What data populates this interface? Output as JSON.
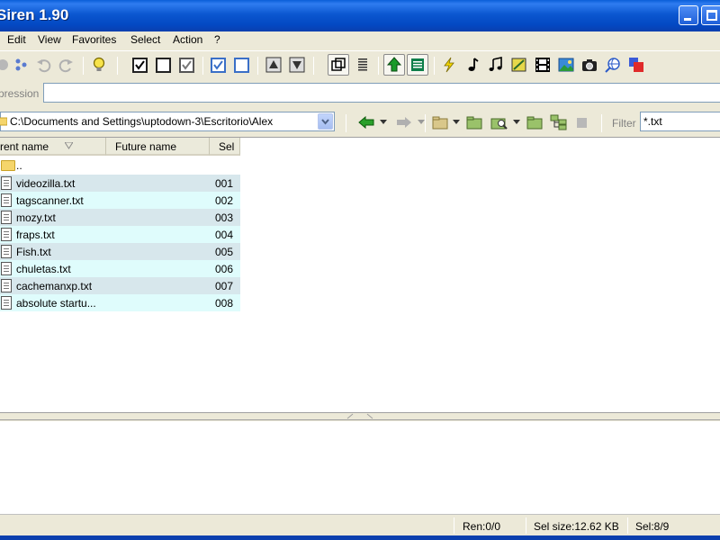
{
  "window": {
    "title": "Siren 1.90"
  },
  "menu": [
    "Edit",
    "View",
    "Favorites",
    "Select",
    "Action",
    "?"
  ],
  "toolbar": {
    "icons": [
      "record-icon",
      "dots-icon",
      "undo-icon",
      "redo-icon",
      "lightbulb-icon",
      "check-all-icon",
      "uncheck-all-icon",
      "check-dim-icon",
      "check-blue-icon",
      "uncheck-blue-icon",
      "move-up-icon",
      "move-down-icon",
      "copy-window-icon",
      "list-icon",
      "tree-up-icon",
      "list-equal-icon",
      "lightning-icon",
      "note-icon",
      "notes-icon",
      "image-edit-icon",
      "film-icon",
      "picture-icon",
      "camera-icon",
      "globe-icon",
      "color-squares-icon"
    ]
  },
  "expression": {
    "label": "pression",
    "value": ""
  },
  "path": {
    "value": "C:\\Documents and Settings\\uptodown-3\\Escritorio\\Alex"
  },
  "filter": {
    "label": "Filter",
    "value": "*.txt"
  },
  "columns": {
    "current": "rrent name",
    "future": "Future name",
    "sel": "Sel"
  },
  "parent_row": {
    "name": ".."
  },
  "files": [
    {
      "name": "videozilla.txt",
      "sel": "001"
    },
    {
      "name": "tagscanner.txt",
      "sel": "002"
    },
    {
      "name": "mozy.txt",
      "sel": "003"
    },
    {
      "name": "fraps.txt",
      "sel": "004"
    },
    {
      "name": "Fish.txt",
      "sel": "005"
    },
    {
      "name": "chuletas.txt",
      "sel": "006"
    },
    {
      "name": "cachemanxp.txt",
      "sel": "007"
    },
    {
      "name": "absolute startu...",
      "sel": "008"
    }
  ],
  "status": {
    "ren": "Ren:0/0",
    "selsize": "Sel size:12.62 KB",
    "sel": "Sel:8/9"
  },
  "colors": {
    "titlebar": "#0b57d0",
    "row_a": "#d7e7ec",
    "row_b": "#dffcfc"
  }
}
